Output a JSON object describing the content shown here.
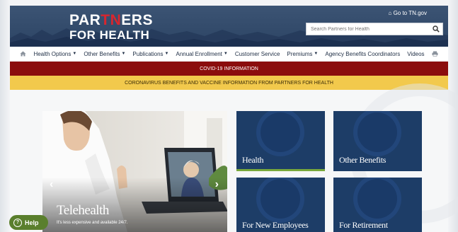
{
  "header": {
    "logo_line1_a": "PAR",
    "logo_line1_tn": "TN",
    "logo_line1_b": "ERS",
    "logo_line2": "FOR HEALTH",
    "go_to_tn": "Go to TN.gov",
    "search_placeholder": "Search Partners for Health"
  },
  "nav": {
    "items": [
      {
        "label": "Health Options",
        "dropdown": true
      },
      {
        "label": "Other Benefits",
        "dropdown": true
      },
      {
        "label": "Publications",
        "dropdown": true
      },
      {
        "label": "Annual Enrollment",
        "dropdown": true
      },
      {
        "label": "Customer Service",
        "dropdown": false
      },
      {
        "label": "Premiums",
        "dropdown": true
      },
      {
        "label": "Agency Benefits Coordinators",
        "dropdown": false
      },
      {
        "label": "Videos",
        "dropdown": false
      }
    ]
  },
  "banners": {
    "covid": "COVID-19 INFORMATION",
    "coronavirus": "CORONAVIRUS BENEFITS AND VACCINE INFORMATION FROM PARTNERS FOR HEALTH"
  },
  "hero": {
    "title": "Telehealth",
    "subtitle": "It's less expensive and available 24/7."
  },
  "tiles": [
    {
      "label": "Health"
    },
    {
      "label": "Other Benefits"
    },
    {
      "label": "For New Employees"
    },
    {
      "label": "For Retirement"
    }
  ],
  "help": {
    "label": "Help"
  },
  "colors": {
    "header_bg": "#2c4464",
    "covid_banner": "#8b0d0d",
    "corona_banner": "#f2c94c",
    "tile_bg": "#1d3d67",
    "help_button": "#5a7f2d",
    "logo_tn": "#d9262e"
  }
}
